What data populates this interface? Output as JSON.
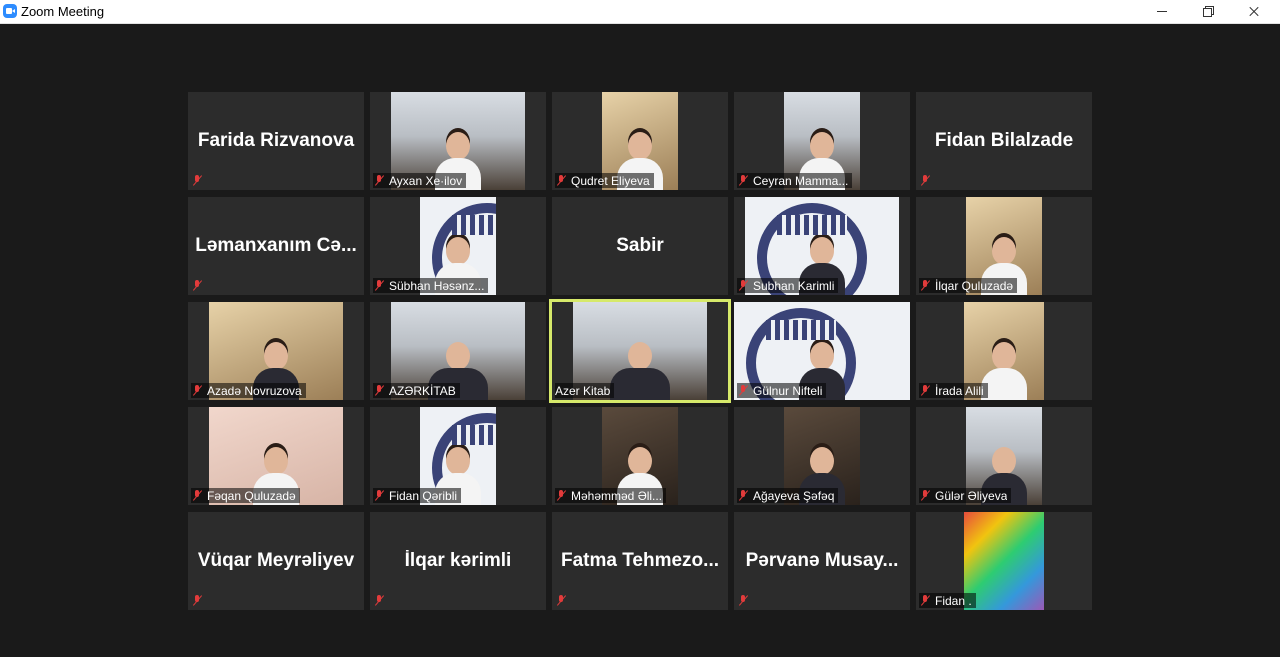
{
  "window": {
    "title": "Zoom Meeting"
  },
  "tiles": [
    {
      "display": "Farida Rizvanova",
      "name": "",
      "video": false
    },
    {
      "display": "",
      "name": "Ayxan Xe·ilov",
      "video": true
    },
    {
      "display": "",
      "name": "Qudret Eliyeva",
      "video": true
    },
    {
      "display": "",
      "name": "Ceyran Mamma...",
      "video": true
    },
    {
      "display": "Fidan Bilalzade",
      "name": "",
      "video": false
    },
    {
      "display": "Ləmanxanım  Cə...",
      "name": "",
      "video": false
    },
    {
      "display": "",
      "name": "Sübhan Həsənz...",
      "video": true
    },
    {
      "display": "Sabir",
      "name": "",
      "video": false
    },
    {
      "display": "",
      "name": "Subhan Karimli",
      "video": true
    },
    {
      "display": "",
      "name": "İlqar Quluzadə",
      "video": true
    },
    {
      "display": "",
      "name": "Azadə Novruzova",
      "video": true
    },
    {
      "display": "",
      "name": "AZƏRKİTAB",
      "video": true
    },
    {
      "display": "",
      "name": "Azer Kitab",
      "video": true,
      "active": true
    },
    {
      "display": "",
      "name": "Gülnur Nifteli",
      "video": true
    },
    {
      "display": "",
      "name": "İrada Alili",
      "video": true
    },
    {
      "display": "",
      "name": "Fəqan Quluzadə",
      "video": true
    },
    {
      "display": "",
      "name": "Fidan Qəribli",
      "video": true
    },
    {
      "display": "",
      "name": "Məhəmməd Əli...",
      "video": true
    },
    {
      "display": "",
      "name": "Ağayeva Şəfəq",
      "video": true
    },
    {
      "display": "",
      "name": "Gülər Əliyeva",
      "video": true
    },
    {
      "display": "Vüqar Meyrəliyev",
      "name": "",
      "video": false
    },
    {
      "display": "İlqar kərimli",
      "name": "",
      "video": false
    },
    {
      "display": "Fatma  Tehmezo...",
      "name": "",
      "video": false
    },
    {
      "display": "Pərvanə  Musay...",
      "name": "",
      "video": false
    },
    {
      "display": "",
      "name": "Fidan .",
      "video": true
    }
  ]
}
